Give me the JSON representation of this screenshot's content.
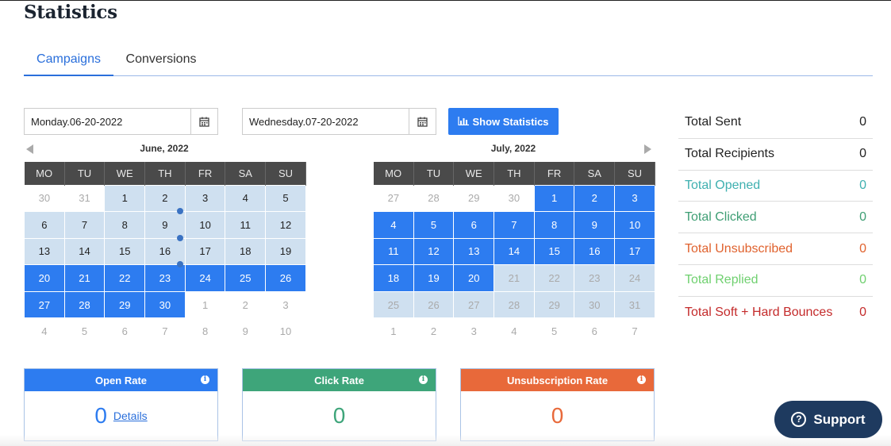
{
  "page": {
    "title": "Statistics"
  },
  "tabs": [
    {
      "label": "Campaigns",
      "active": true
    },
    {
      "label": "Conversions",
      "active": false
    }
  ],
  "date_from": {
    "value": "Monday.06-20-2022",
    "icon": "calendar-icon"
  },
  "date_to": {
    "value": "Wednesday.07-20-2022",
    "icon": "calendar-icon"
  },
  "show_button": {
    "label": "Show Statistics",
    "icon": "bar-chart-icon",
    "color": "#2d7cf0"
  },
  "weekdays": [
    "MO",
    "TU",
    "WE",
    "TH",
    "FR",
    "SA",
    "SU"
  ],
  "calendars": [
    {
      "title": "June, 2022",
      "weeks": [
        [
          {
            "d": "30",
            "s": "dim"
          },
          {
            "d": "31",
            "s": "dim"
          },
          {
            "d": "1",
            "s": "range"
          },
          {
            "d": "2",
            "s": "range",
            "dot": true
          },
          {
            "d": "3",
            "s": "range"
          },
          {
            "d": "4",
            "s": "range"
          },
          {
            "d": "5",
            "s": "range"
          }
        ],
        [
          {
            "d": "6",
            "s": "range"
          },
          {
            "d": "7",
            "s": "range"
          },
          {
            "d": "8",
            "s": "range"
          },
          {
            "d": "9",
            "s": "range",
            "dot": true
          },
          {
            "d": "10",
            "s": "range"
          },
          {
            "d": "11",
            "s": "range"
          },
          {
            "d": "12",
            "s": "range"
          }
        ],
        [
          {
            "d": "13",
            "s": "range"
          },
          {
            "d": "14",
            "s": "range"
          },
          {
            "d": "15",
            "s": "range"
          },
          {
            "d": "16",
            "s": "range",
            "dot": true
          },
          {
            "d": "17",
            "s": "range"
          },
          {
            "d": "18",
            "s": "range"
          },
          {
            "d": "19",
            "s": "range"
          }
        ],
        [
          {
            "d": "20",
            "s": "sel"
          },
          {
            "d": "21",
            "s": "sel"
          },
          {
            "d": "22",
            "s": "sel"
          },
          {
            "d": "23",
            "s": "sel"
          },
          {
            "d": "24",
            "s": "sel"
          },
          {
            "d": "25",
            "s": "sel"
          },
          {
            "d": "26",
            "s": "sel"
          }
        ],
        [
          {
            "d": "27",
            "s": "sel"
          },
          {
            "d": "28",
            "s": "sel"
          },
          {
            "d": "29",
            "s": "sel"
          },
          {
            "d": "30",
            "s": "sel"
          },
          {
            "d": "1",
            "s": "dim"
          },
          {
            "d": "2",
            "s": "dim"
          },
          {
            "d": "3",
            "s": "dim"
          }
        ],
        [
          {
            "d": "4",
            "s": "dim"
          },
          {
            "d": "5",
            "s": "dim"
          },
          {
            "d": "6",
            "s": "dim"
          },
          {
            "d": "7",
            "s": "dim"
          },
          {
            "d": "8",
            "s": "dim"
          },
          {
            "d": "9",
            "s": "dim"
          },
          {
            "d": "10",
            "s": "dim"
          }
        ]
      ]
    },
    {
      "title": "July, 2022",
      "weeks": [
        [
          {
            "d": "27",
            "s": "dim"
          },
          {
            "d": "28",
            "s": "dim"
          },
          {
            "d": "29",
            "s": "dim"
          },
          {
            "d": "30",
            "s": "dim"
          },
          {
            "d": "1",
            "s": "sel"
          },
          {
            "d": "2",
            "s": "sel"
          },
          {
            "d": "3",
            "s": "sel"
          }
        ],
        [
          {
            "d": "4",
            "s": "sel"
          },
          {
            "d": "5",
            "s": "sel"
          },
          {
            "d": "6",
            "s": "sel"
          },
          {
            "d": "7",
            "s": "sel"
          },
          {
            "d": "8",
            "s": "sel"
          },
          {
            "d": "9",
            "s": "sel"
          },
          {
            "d": "10",
            "s": "sel"
          }
        ],
        [
          {
            "d": "11",
            "s": "sel"
          },
          {
            "d": "12",
            "s": "sel"
          },
          {
            "d": "13",
            "s": "sel"
          },
          {
            "d": "14",
            "s": "sel"
          },
          {
            "d": "15",
            "s": "sel"
          },
          {
            "d": "16",
            "s": "sel"
          },
          {
            "d": "17",
            "s": "sel"
          }
        ],
        [
          {
            "d": "18",
            "s": "sel"
          },
          {
            "d": "19",
            "s": "sel"
          },
          {
            "d": "20",
            "s": "sel"
          },
          {
            "d": "21",
            "s": "rangedim"
          },
          {
            "d": "22",
            "s": "rangedim"
          },
          {
            "d": "23",
            "s": "rangedim"
          },
          {
            "d": "24",
            "s": "rangedim"
          }
        ],
        [
          {
            "d": "25",
            "s": "rangedim"
          },
          {
            "d": "26",
            "s": "rangedim"
          },
          {
            "d": "27",
            "s": "rangedim"
          },
          {
            "d": "28",
            "s": "rangedim"
          },
          {
            "d": "29",
            "s": "rangedim"
          },
          {
            "d": "30",
            "s": "rangedim"
          },
          {
            "d": "31",
            "s": "rangedim"
          }
        ],
        [
          {
            "d": "1",
            "s": "dim"
          },
          {
            "d": "2",
            "s": "dim"
          },
          {
            "d": "3",
            "s": "dim"
          },
          {
            "d": "4",
            "s": "dim"
          },
          {
            "d": "5",
            "s": "dim"
          },
          {
            "d": "6",
            "s": "dim"
          },
          {
            "d": "7",
            "s": "dim"
          }
        ]
      ]
    }
  ],
  "totals": [
    {
      "label": "Total Sent",
      "value": "0",
      "color": "#222222"
    },
    {
      "label": "Total Recipients",
      "value": "0",
      "color": "#222222"
    },
    {
      "label": "Total Opened",
      "value": "0",
      "color": "#3fb0b0"
    },
    {
      "label": "Total Clicked",
      "value": "0",
      "color": "#3e9e74"
    },
    {
      "label": "Total Unsubscribed",
      "value": "0",
      "color": "#e0622e"
    },
    {
      "label": "Total Replied",
      "value": "0",
      "color": "#6fd06f"
    },
    {
      "label": "Total Soft + Hard Bounces",
      "value": "0",
      "color": "#c42b2b"
    }
  ],
  "rates": [
    {
      "title": "Open Rate",
      "value": "0",
      "link": "Details",
      "color": "#2d7cf0"
    },
    {
      "title": "Click Rate",
      "value": "0",
      "color": "#3ea57a"
    },
    {
      "title": "Unsubscription Rate",
      "value": "0",
      "color": "#e8693a"
    }
  ],
  "support": {
    "label": "Support",
    "icon": "question-circle-icon",
    "color": "#1e3a5f"
  }
}
